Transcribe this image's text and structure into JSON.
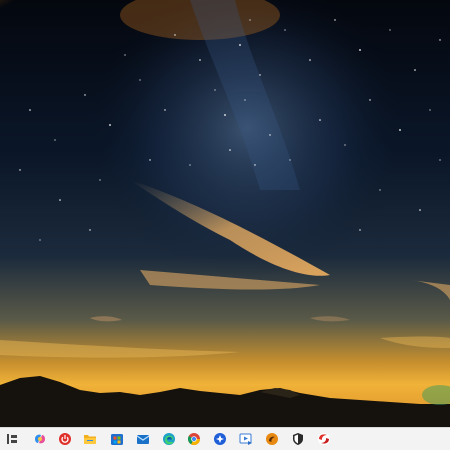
{
  "wallpaper": {
    "name": "starry-night-milky-way-wallpaper",
    "colors": {
      "sky_top": "#05080f",
      "sky_mid": "#0c1a30",
      "horizon_glow": "#e8a22a",
      "orange_cloud": "#d9891e",
      "mountains": "#14100c"
    }
  },
  "taskbar": {
    "background": "#f3f3f3",
    "items": [
      {
        "id": "task-view",
        "icon": "task-view-icon"
      },
      {
        "id": "copilot",
        "icon": "copilot-icon"
      },
      {
        "id": "power-app",
        "icon": "red-power-icon"
      },
      {
        "id": "file-explorer",
        "icon": "folder-icon"
      },
      {
        "id": "windows-store",
        "icon": "store-icon"
      },
      {
        "id": "mail",
        "icon": "mail-icon"
      },
      {
        "id": "edge",
        "icon": "edge-browser-icon"
      },
      {
        "id": "chrome",
        "icon": "chrome-browser-icon"
      },
      {
        "id": "blue-app",
        "icon": "blue-circle-app-icon"
      },
      {
        "id": "media-player",
        "icon": "media-player-icon"
      },
      {
        "id": "orange-app",
        "icon": "orange-swirl-app-icon"
      },
      {
        "id": "security",
        "icon": "shield-icon"
      },
      {
        "id": "red-app",
        "icon": "red-swirl-app-icon"
      }
    ]
  }
}
